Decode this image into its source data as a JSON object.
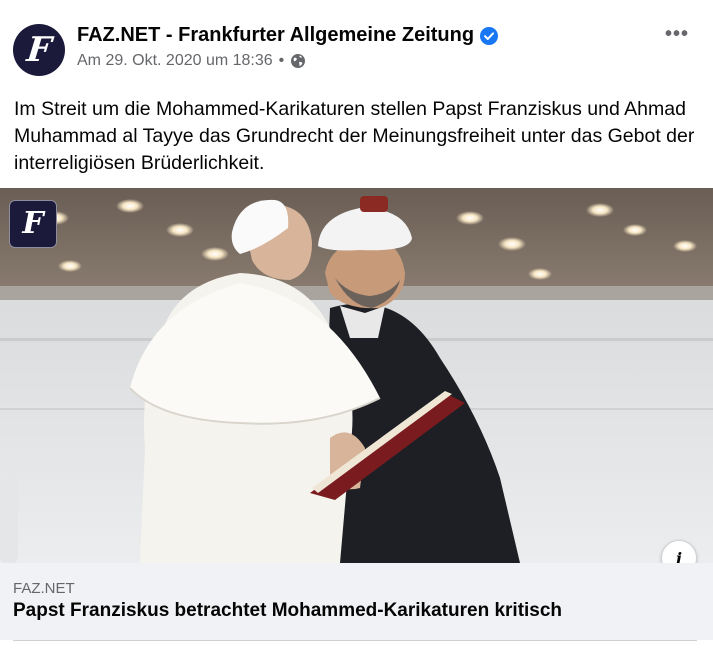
{
  "post": {
    "page_name": "FAZ.NET - Frankfurter Allgemeine Zeitung",
    "avatar_letter": "F",
    "timestamp": "Am 29. Okt. 2020 um 18:36",
    "separator": "•",
    "audience_icon": "globe-icon",
    "verified_icon": "verified-badge-icon",
    "more_icon": "•••",
    "text": "Im Streit um die Mohammed-Karikaturen stellen Papst Franziskus und Ahmad Muhammad al Tayye das Grundrecht der Meinungsfreiheit unter das Gebot der interreligiösen Brüderlichkeit."
  },
  "link": {
    "image_logo_letter": "F",
    "info_icon": "i",
    "domain": "FAZ.NET",
    "title": "Papst Franziskus betrachtet Mohammed-Karikaturen kritisch"
  },
  "colors": {
    "verified_blue": "#1877f2",
    "avatar_navy": "#1c1a3a",
    "secondary_text": "#65676b",
    "caption_bg": "#f0f2f5"
  }
}
